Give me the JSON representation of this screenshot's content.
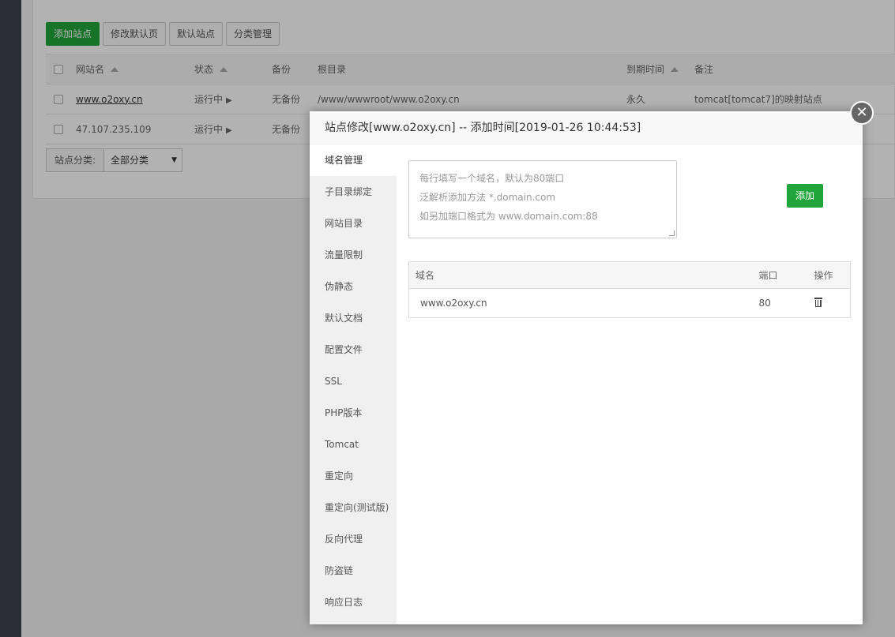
{
  "toolbar": {
    "add_site": "添加站点",
    "edit_default_page": "修改默认页",
    "default_site": "默认站点",
    "category_manage": "分类管理"
  },
  "sites_table": {
    "headers": {
      "name": "网站名",
      "status": "状态",
      "backup": "备份",
      "root": "根目录",
      "expire": "到期时间",
      "remark": "备注"
    },
    "rows": [
      {
        "name": "www.o2oxy.cn",
        "status": "运行中",
        "backup": "无备份",
        "root": "/www/wwwroot/www.o2oxy.cn",
        "expire": "永久",
        "remark": "tomcat[tomcat7]的映射站点"
      },
      {
        "name": "47.107.235.109",
        "status": "运行中",
        "backup": "无备份",
        "root": "",
        "expire": "",
        "remark": ""
      }
    ]
  },
  "classify": {
    "label": "站点分类:",
    "selected": "全部分类"
  },
  "modal": {
    "title": "站点修改[www.o2oxy.cn] -- 添加时间[2019-01-26 10:44:53]",
    "tabs": [
      "域名管理",
      "子目录绑定",
      "网站目录",
      "流量限制",
      "伪静态",
      "默认文档",
      "配置文件",
      "SSL",
      "PHP版本",
      "Tomcat",
      "重定向",
      "重定向(测试版)",
      "反向代理",
      "防盗链",
      "响应日志"
    ],
    "domain_placeholder": [
      "每行填写一个域名，默认为80端口",
      "泛解析添加方法 *.domain.com",
      "如另加端口格式为 www.domain.com:88"
    ],
    "add_button": "添加",
    "table": {
      "headers": {
        "domain": "域名",
        "port": "端口",
        "action": "操作"
      },
      "rows": [
        {
          "domain": "www.o2oxy.cn",
          "port": "80"
        }
      ]
    }
  }
}
